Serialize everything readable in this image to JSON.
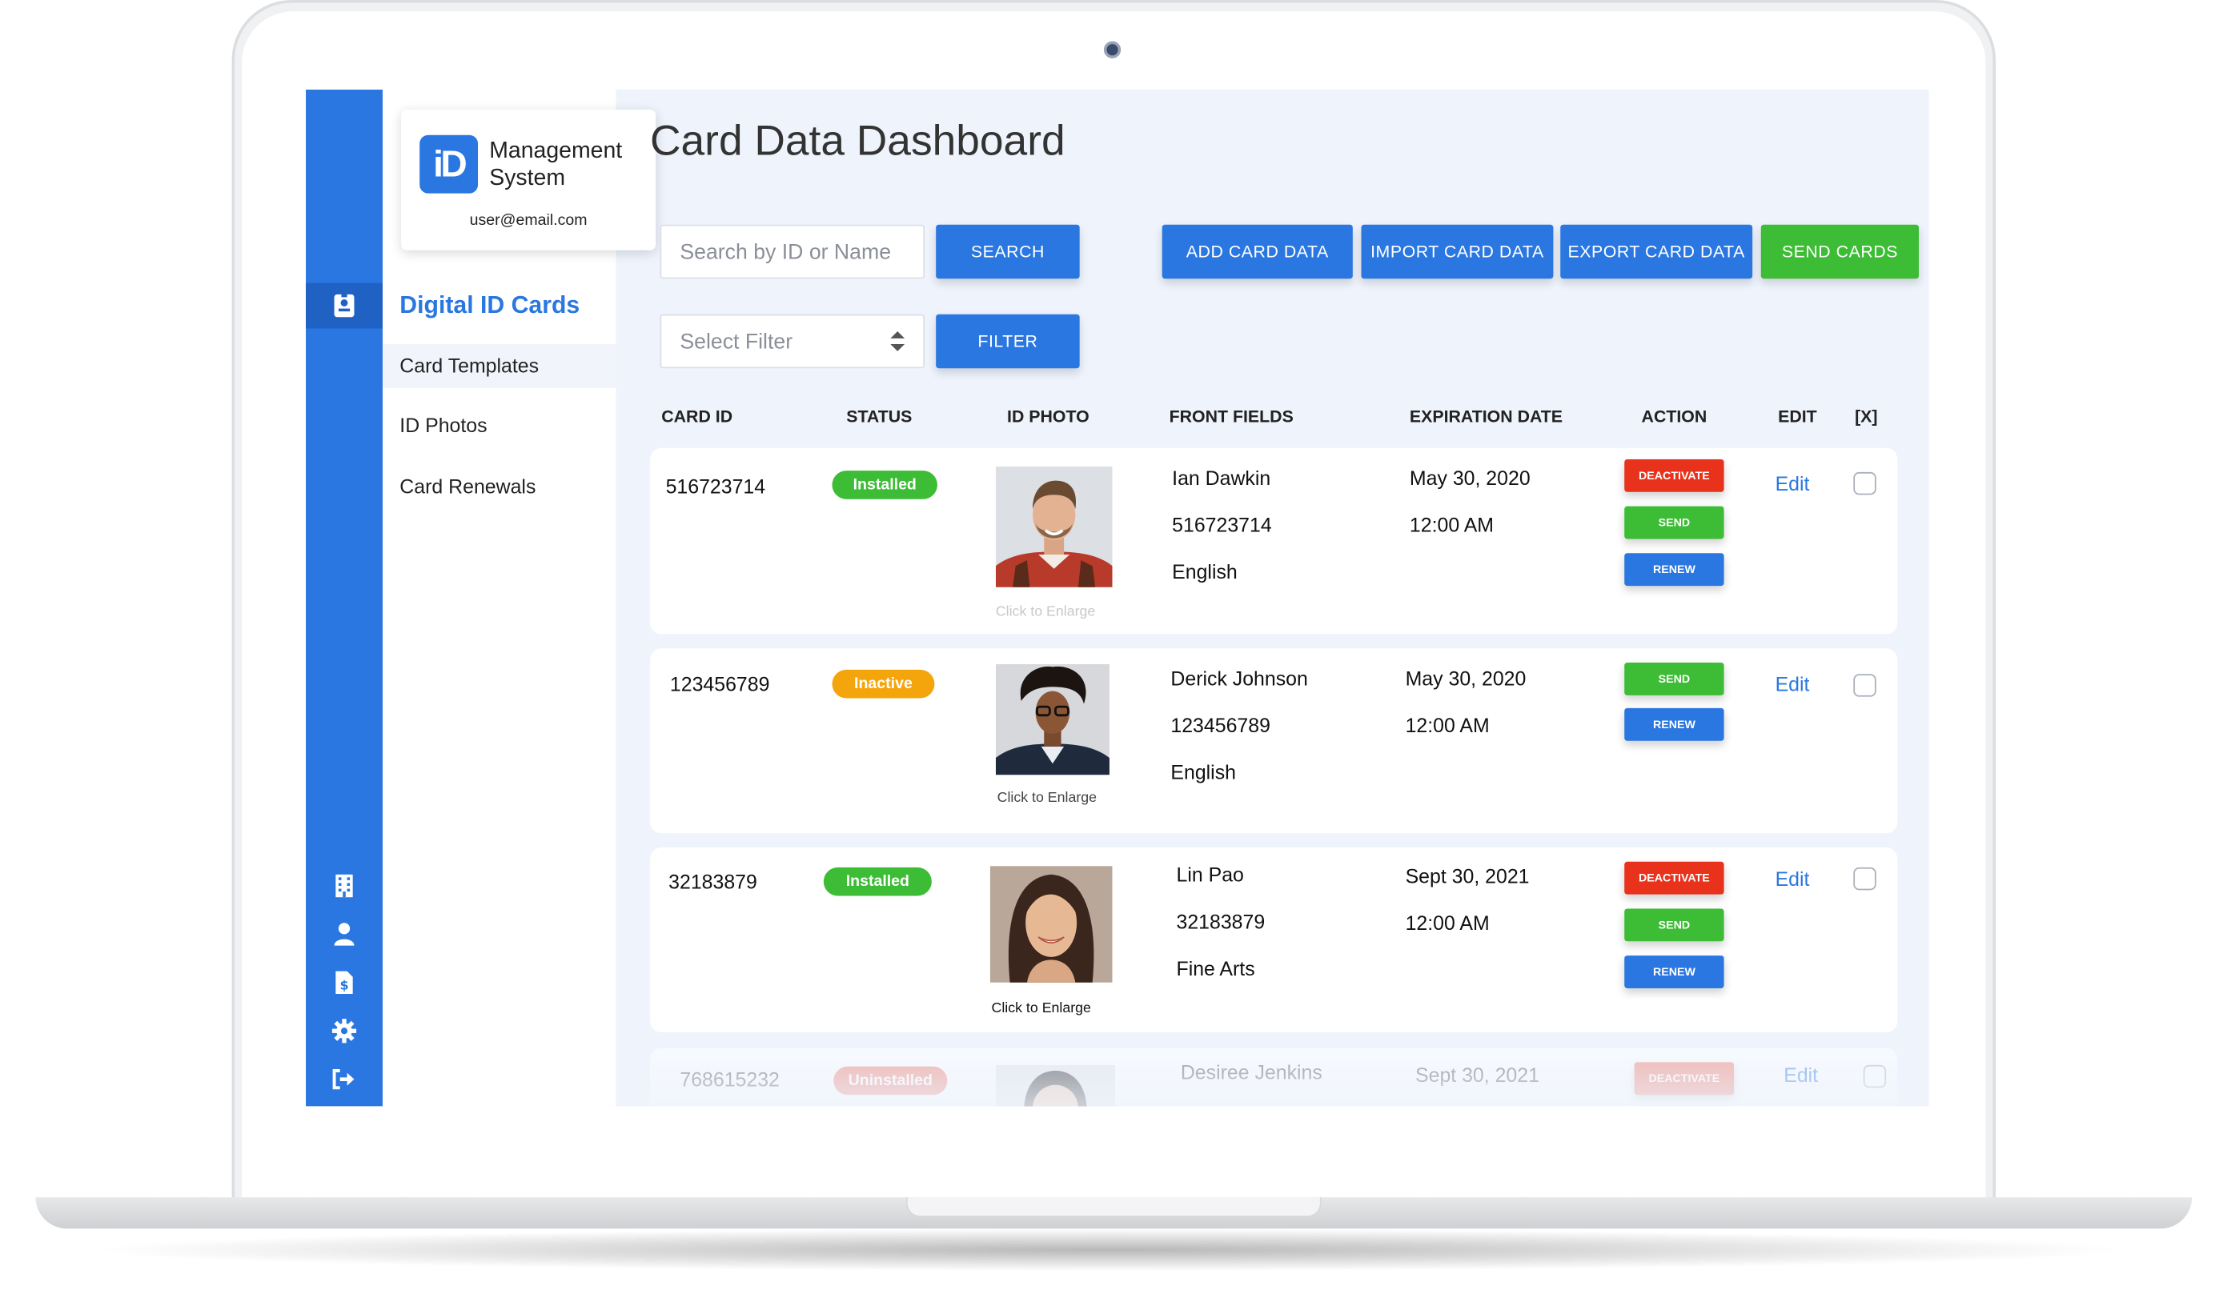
{
  "app": {
    "logo_glyph": "iD",
    "logo_line1": "Management",
    "logo_line2": "System",
    "user_email": "user@email.com"
  },
  "nav": {
    "title": "Digital ID Cards",
    "items": [
      {
        "label": "Card Templates"
      },
      {
        "label": "ID Photos"
      },
      {
        "label": "Card Renewals"
      }
    ]
  },
  "rail_icons": [
    "id-card-icon",
    "building-icon",
    "user-icon",
    "invoice-icon",
    "gear-icon",
    "logout-icon"
  ],
  "main": {
    "title": "Card Data Dashboard",
    "search_placeholder": "Search by ID or Name",
    "search_button": "SEARCH",
    "filter_placeholder": "Select Filter",
    "filter_button": "FILTER",
    "actions": {
      "add": "ADD CARD DATA",
      "import": "IMPORT CARD DATA",
      "export": "EXPORT CARD DATA",
      "send": "SEND CARDS"
    }
  },
  "table": {
    "headers": [
      "CARD ID",
      "STATUS",
      "ID PHOTO",
      "FRONT FIELDS",
      "EXPIRATION DATE",
      "ACTION",
      "EDIT",
      "[X]"
    ],
    "photo_caption": "Click to Enlarge",
    "edit_label": "Edit",
    "action_labels": {
      "deactivate": "DEACTIVATE",
      "send": "SEND",
      "renew": "RENEW"
    },
    "rows": [
      {
        "card_id": "516723714",
        "status": "Installed",
        "name": "Ian Dawkin",
        "id_field": "516723714",
        "dept": "English",
        "exp_date": "May 30, 2020",
        "exp_time": "12:00 AM"
      },
      {
        "card_id": "123456789",
        "status": "Inactive",
        "name": "Derick Johnson",
        "id_field": "123456789",
        "dept": "English",
        "exp_date": "May 30, 2020",
        "exp_time": "12:00 AM"
      },
      {
        "card_id": "32183879",
        "status": "Installed",
        "name": "Lin Pao",
        "id_field": "32183879",
        "dept": "Fine Arts",
        "exp_date": "Sept 30, 2021",
        "exp_time": "12:00 AM"
      },
      {
        "card_id": "768615232",
        "status": "Uninstalled",
        "name": "Desiree Jenkins",
        "exp_date": "Sept 30, 2021"
      }
    ]
  },
  "colors": {
    "primary": "#2a77e1",
    "success": "#3dbd35",
    "danger": "#e8321c",
    "warning": "#f5a50c",
    "uninstalled": "#f08070"
  }
}
